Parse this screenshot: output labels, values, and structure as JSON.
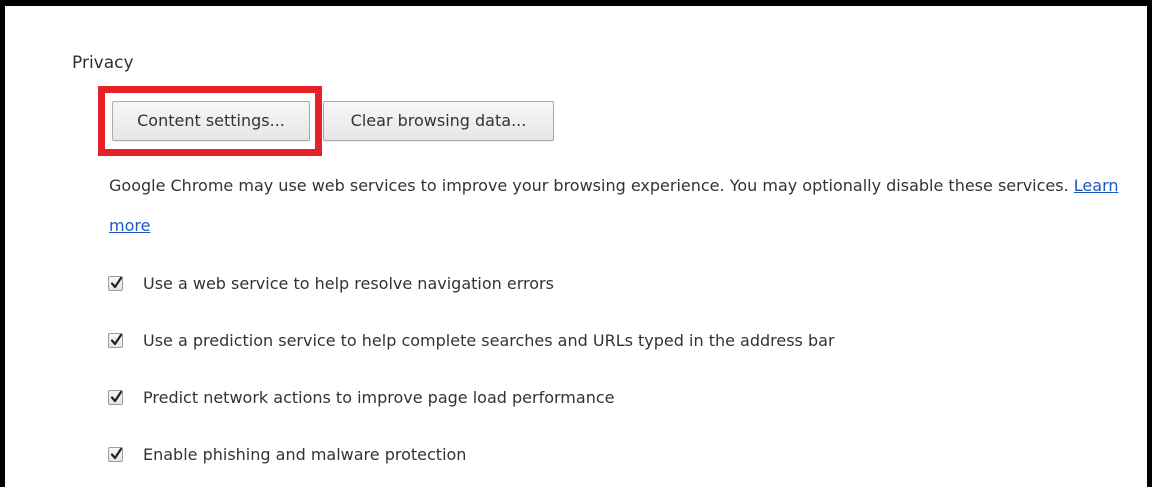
{
  "privacy": {
    "title": "Privacy",
    "buttons": {
      "content_settings": "Content settings...",
      "clear_browsing_data": "Clear browsing data..."
    },
    "description": "Google Chrome may use web services to improve your browsing experience. You may optionally disable these services.",
    "learn_more": "Learn more",
    "options": [
      {
        "label": "Use a web service to help resolve navigation errors",
        "checked": true
      },
      {
        "label": "Use a prediction service to help complete searches and URLs typed in the address bar",
        "checked": true
      },
      {
        "label": "Predict network actions to improve page load performance",
        "checked": true
      },
      {
        "label": "Enable phishing and malware protection",
        "checked": true
      }
    ]
  },
  "colors": {
    "highlight": "#e8202a",
    "link": "#1d57c4",
    "frame": "#000000"
  },
  "icons": {
    "checkbox_mark": "checkmark-icon"
  }
}
